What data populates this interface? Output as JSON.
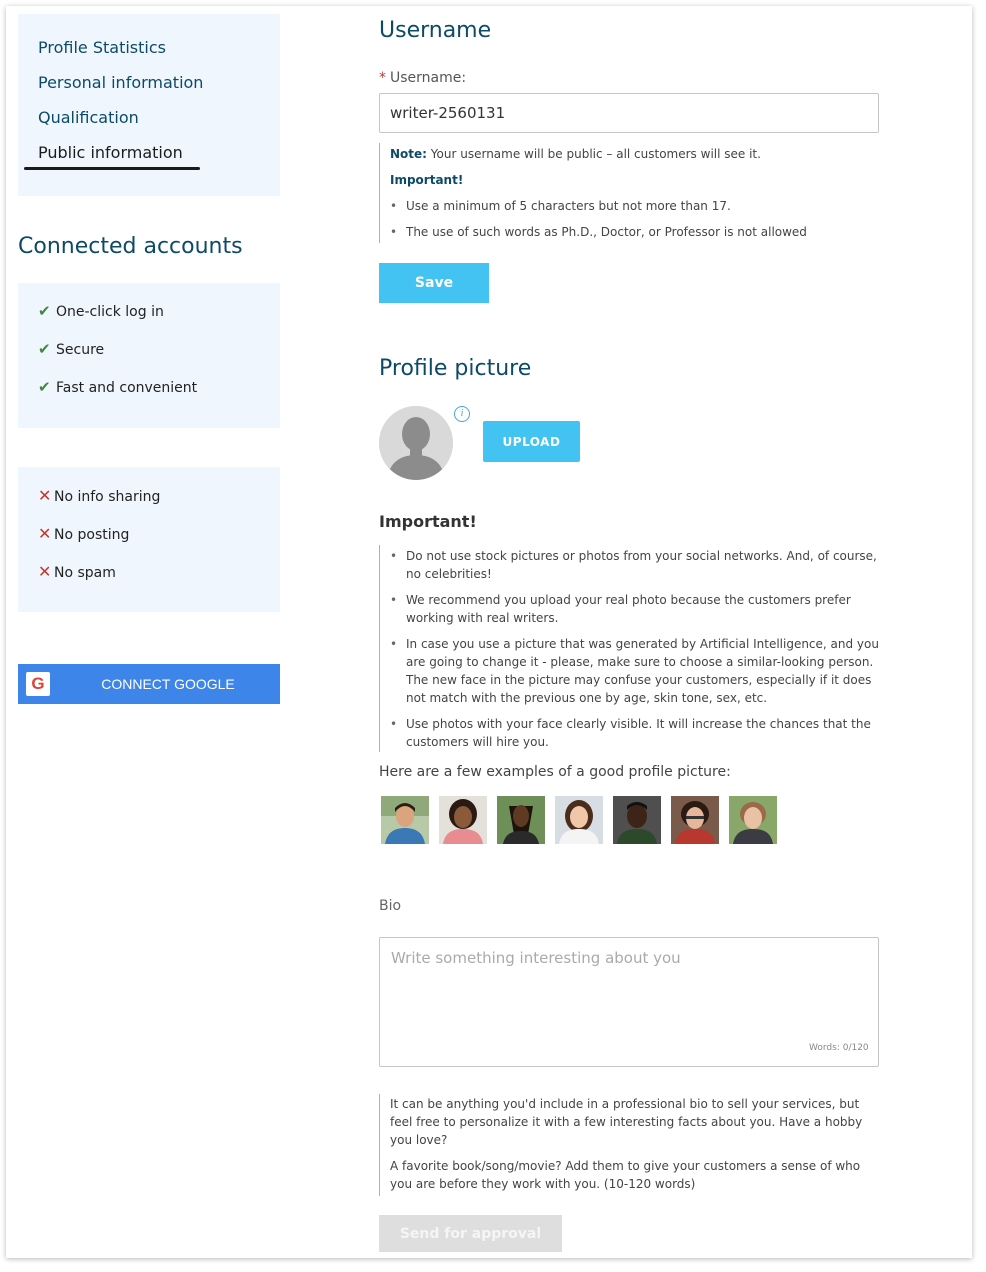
{
  "sidebar": {
    "nav": [
      {
        "label": "Profile Statistics"
      },
      {
        "label": "Personal information"
      },
      {
        "label": "Qualification"
      },
      {
        "label": "Public information"
      }
    ],
    "connected_title": "Connected accounts",
    "pros": [
      {
        "label": "One-click log in"
      },
      {
        "label": "Secure"
      },
      {
        "label": "Fast and convenient"
      }
    ],
    "cons": [
      {
        "label": "No info sharing"
      },
      {
        "label": "No posting"
      },
      {
        "label": "No spam"
      }
    ],
    "google_button": {
      "label": "CONNECT GOOGLE",
      "logo": "G"
    },
    "check_glyph": "✔",
    "cross_glyph": "✕"
  },
  "username_section": {
    "title": "Username",
    "required_mark": "*",
    "label": "Username:",
    "value": "writer-2560131",
    "note_label": "Note:",
    "note_text": "Your username will be public – all customers will see it.",
    "important_label": "Important!",
    "rules": [
      "Use a minimum of 5 characters but not more than 17.",
      "The use of such words as Ph.D., Doctor, or Professor is not allowed"
    ],
    "save_label": "Save"
  },
  "picture_section": {
    "title": "Profile picture",
    "info_icon": "i",
    "upload_label": "UPLOAD",
    "important_title": "Important!",
    "rules": [
      "Do not use stock pictures or photos from your social networks. And, of course, no celebrities!",
      "We recommend you upload your real photo because the customers prefer working with real writers.",
      "In case you use a picture that was generated by Artificial Intelligence, and you are going to change it - please, make sure to choose a similar-looking person. The new face in the picture may confuse your customers, especially if it does not match with the previous one by age, skin tone, sex, etc.",
      "Use photos with your face clearly visible. It will increase the chances that the customers will hire you."
    ],
    "examples_label": "Here are a few examples of a good profile picture:"
  },
  "bio_section": {
    "label": "Bio",
    "placeholder": "Write something interesting about you",
    "value": "",
    "word_count": "Words: 0/120",
    "tips": [
      "It can be anything you'd include in a professional bio to sell your services, but feel free to personalize it with a few interesting facts about you. Have a hobby you love?",
      "A favorite book/song/movie? Add them to give your customers a sense of who you are before they work with you. (10-120 words)"
    ],
    "submit_label": "Send for approval"
  },
  "colors": {
    "accent": "#43c3f2",
    "heading": "#0d4a68",
    "panel": "#f0f6fd",
    "google": "#3d85e9"
  }
}
